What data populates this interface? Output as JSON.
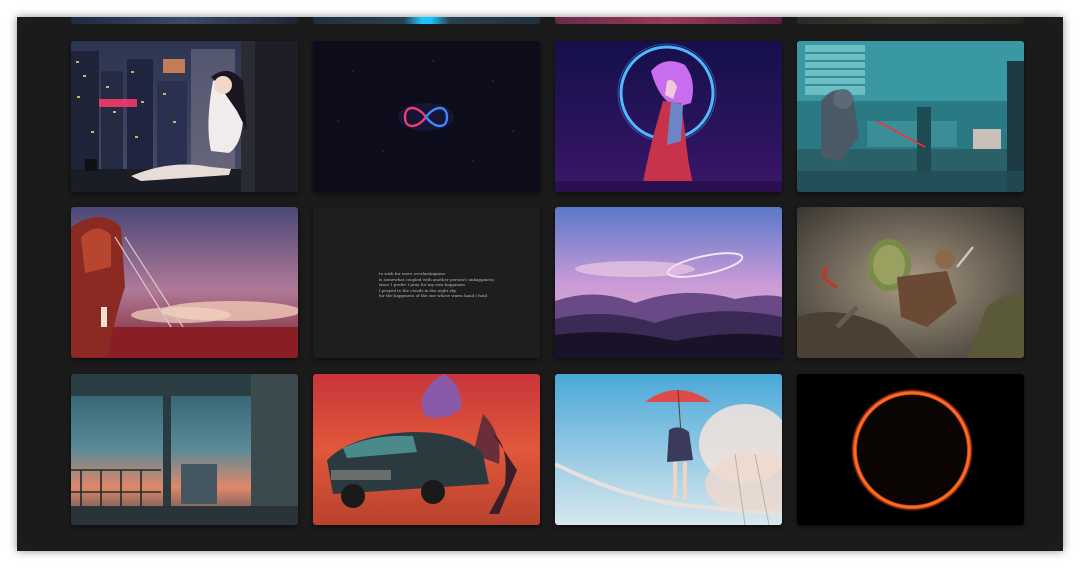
{
  "gallery": {
    "poem_lines": [
      "to wish for more everlastingness",
      "is somewhat coupled with another person's unhappiness",
      "since I prefer I pray for my own happiness",
      "I prayed to the clouds in the night sky",
      "for the happiness of the one whose warm hand I hold"
    ]
  }
}
